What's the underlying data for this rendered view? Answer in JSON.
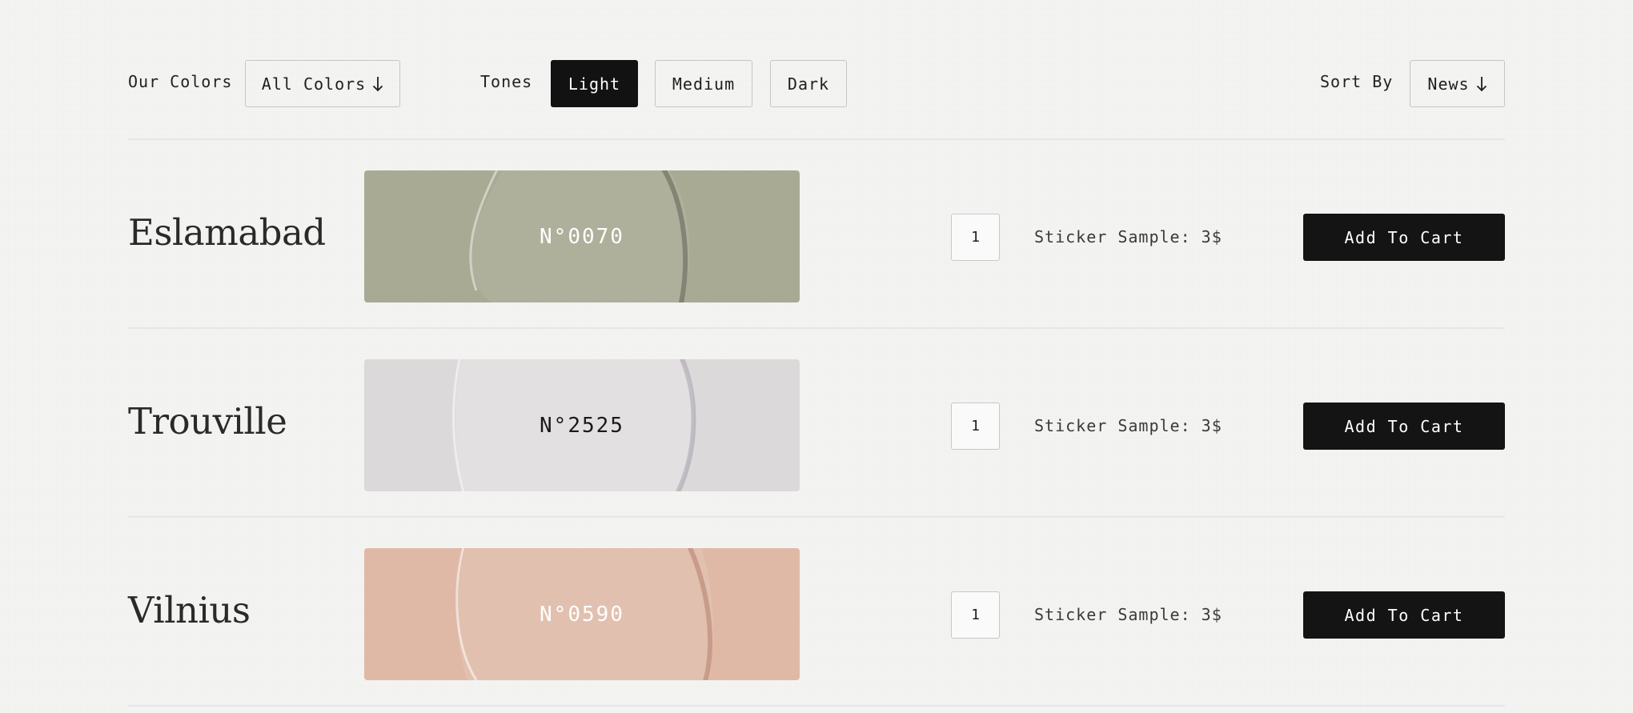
{
  "filters": {
    "colors_label": "Our Colors",
    "colors_select": "All Colors",
    "tones_label": "Tones",
    "tones": [
      {
        "label": "Light",
        "active": true
      },
      {
        "label": "Medium",
        "active": false
      },
      {
        "label": "Dark",
        "active": false
      }
    ],
    "sort_label": "Sort By",
    "sort_select": "News"
  },
  "products": [
    {
      "name": "Eslamabad",
      "code": "N°0070",
      "quantity": "1",
      "price_text": "Sticker Sample: 3$",
      "cart_label": "Add To Cart",
      "swatch_color": "#a9aa93",
      "code_color": "#ffffff"
    },
    {
      "name": "Trouville",
      "code": "N°2525",
      "quantity": "1",
      "price_text": "Sticker Sample: 3$",
      "cart_label": "Add To Cart",
      "swatch_color": "#dcd9db",
      "code_color": "#1a1a1a"
    },
    {
      "name": "Vilnius",
      "code": "N°0590",
      "quantity": "1",
      "price_text": "Sticker Sample: 3$",
      "cart_label": "Add To Cart",
      "swatch_color": "#dfb9a6",
      "code_color": "#ffffff"
    }
  ]
}
